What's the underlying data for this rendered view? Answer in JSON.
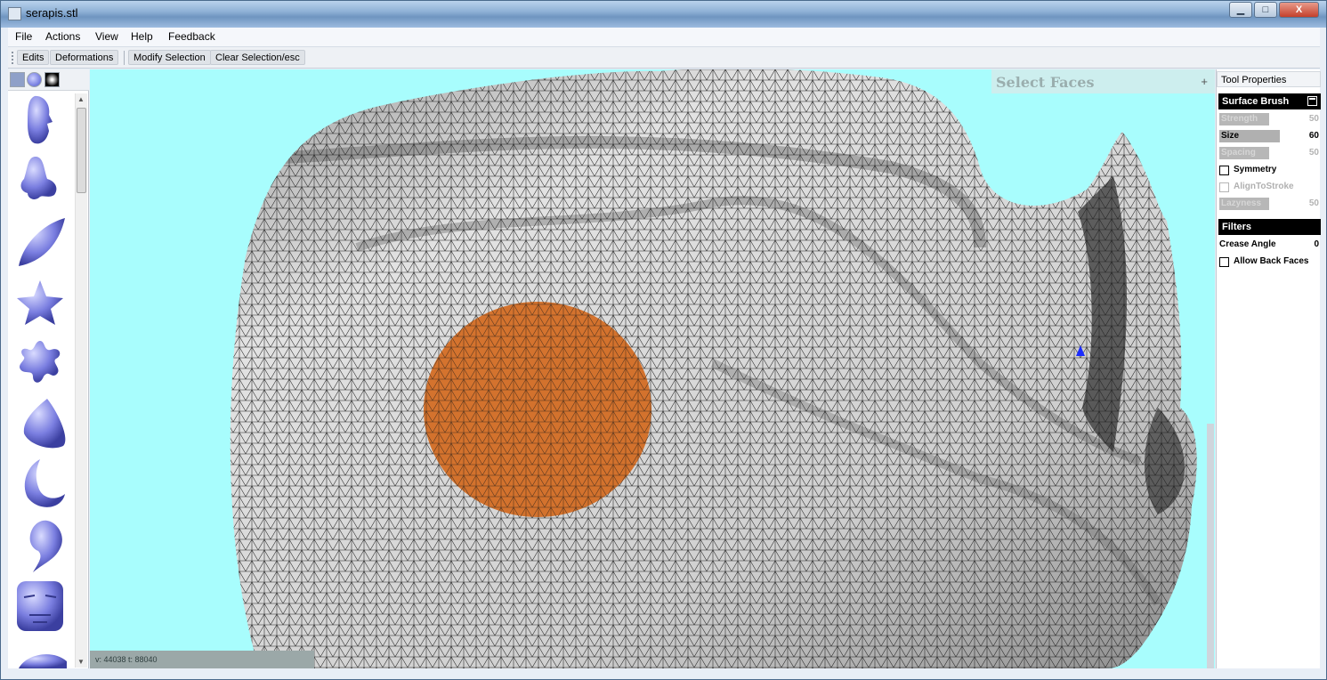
{
  "window": {
    "title": "serapis.stl",
    "controls": {
      "minimize": "▁",
      "maximize": "□",
      "close": "X"
    }
  },
  "menu": [
    "File",
    "Actions",
    "View",
    "Help",
    "Feedback"
  ],
  "toolbar": {
    "edits": "Edits",
    "deformations": "Deformations",
    "modify_selection": "Modify Selection",
    "clear_selection": "Clear Selection/esc"
  },
  "viewport": {
    "hud_title": "Select Faces",
    "hud_plus": "+",
    "status": "v: 44038 t: 88040",
    "colors": {
      "background": "#a8fdfd",
      "mesh": "#d8d8d8",
      "wire": "#2a2a2a",
      "selection": "#d2691e"
    }
  },
  "left_panel": {
    "shapes": [
      "face-icon",
      "nose-icon",
      "leaf-icon",
      "star-icon",
      "splat-icon",
      "wedge-icon",
      "crescent-icon",
      "comma-icon",
      "mask-icon",
      "dome-icon"
    ],
    "shape_color": "#7a7ee0"
  },
  "tool_properties": {
    "header": "Tool Properties",
    "surface_brush": "Surface Brush",
    "strength": {
      "label": "Strength",
      "value": "50"
    },
    "size": {
      "label": "Size",
      "value": "60"
    },
    "spacing": {
      "label": "Spacing",
      "value": "50"
    },
    "symmetry": "Symmetry",
    "align_to_stroke": "AlignToStroke",
    "lazyness": {
      "label": "Lazyness",
      "value": "50"
    },
    "filters": "Filters",
    "crease_angle": {
      "label": "Crease Angle",
      "value": "0"
    },
    "allow_back_faces": "Allow Back Faces"
  }
}
